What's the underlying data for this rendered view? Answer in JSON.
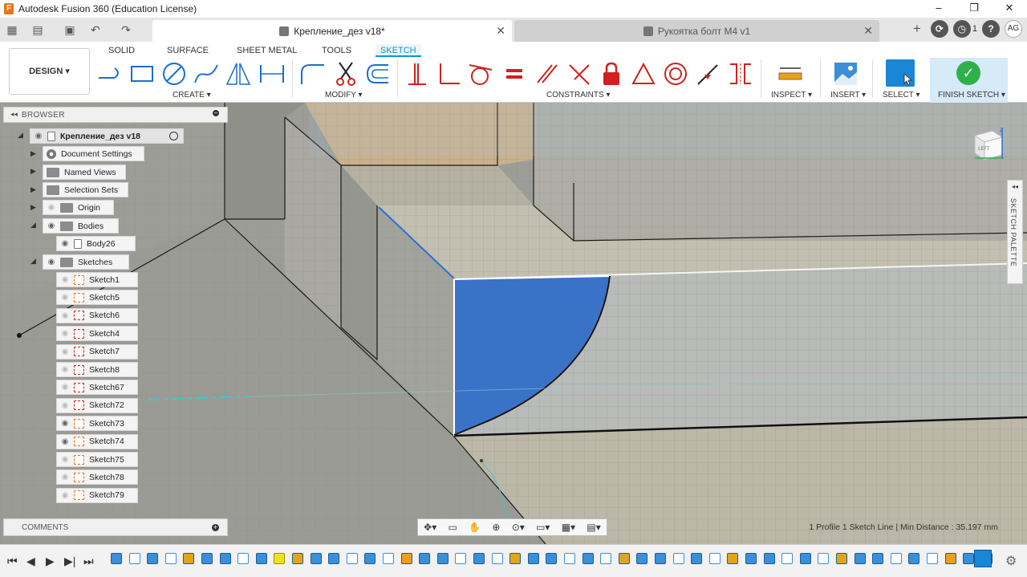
{
  "window": {
    "title": "Autodesk Fusion 360 (Education License)",
    "app_icon_letter": "F",
    "controls": [
      "–",
      "❐",
      "✕"
    ]
  },
  "tabs": {
    "active": {
      "label": "Крепление_дез v18*",
      "close": "✕"
    },
    "inactive": {
      "label": "Рукоятка болт M4 v1",
      "close": "✕"
    },
    "new_tab": "+",
    "job_count": "1",
    "help": "?",
    "avatar_initials": "AG"
  },
  "toolbar": {
    "workspace": "DESIGN",
    "workspace_tabs": [
      "SOLID",
      "SURFACE",
      "SHEET METAL",
      "TOOLS",
      "SKETCH"
    ],
    "groups": {
      "create": "CREATE",
      "modify": "MODIFY",
      "constraints": "CONSTRAINTS",
      "inspect": "INSPECT",
      "insert": "INSERT",
      "select": "SELECT",
      "finish": "FINISH SKETCH"
    }
  },
  "browser": {
    "header": "BROWSER",
    "root": "Крепление_дез v18",
    "items": [
      {
        "label": "Document Settings",
        "icon": "gear-icon"
      },
      {
        "label": "Named Views",
        "icon": "folder-icon"
      },
      {
        "label": "Selection Sets",
        "icon": "folder-icon"
      },
      {
        "label": "Origin",
        "icon": "folder-icon"
      },
      {
        "label": "Bodies",
        "icon": "folder-icon"
      },
      {
        "label": "Body26",
        "icon": "body-icon"
      },
      {
        "label": "Sketches",
        "icon": "folder-icon"
      }
    ],
    "sketches": [
      "Sketch1",
      "Sketch5",
      "Sketch6",
      "Sketch4",
      "Sketch7",
      "Sketch8",
      "Sketch67",
      "Sketch72",
      "Sketch73",
      "Sketch74",
      "Sketch75",
      "Sketch78",
      "Sketch79"
    ]
  },
  "comments": {
    "header": "COMMENTS"
  },
  "status": {
    "text": "1 Profile 1 Sketch Line | Min Distance : 35.197 mm"
  },
  "sketch_palette": {
    "label": "SKETCH PALETTE"
  },
  "viewcube": {
    "face_label": "LEFT"
  },
  "colors": {
    "accent": "#0696d7",
    "profile_fill": "#3a72c8",
    "finish_green": "#2fb14a",
    "select_blue": "#1a86d6"
  }
}
